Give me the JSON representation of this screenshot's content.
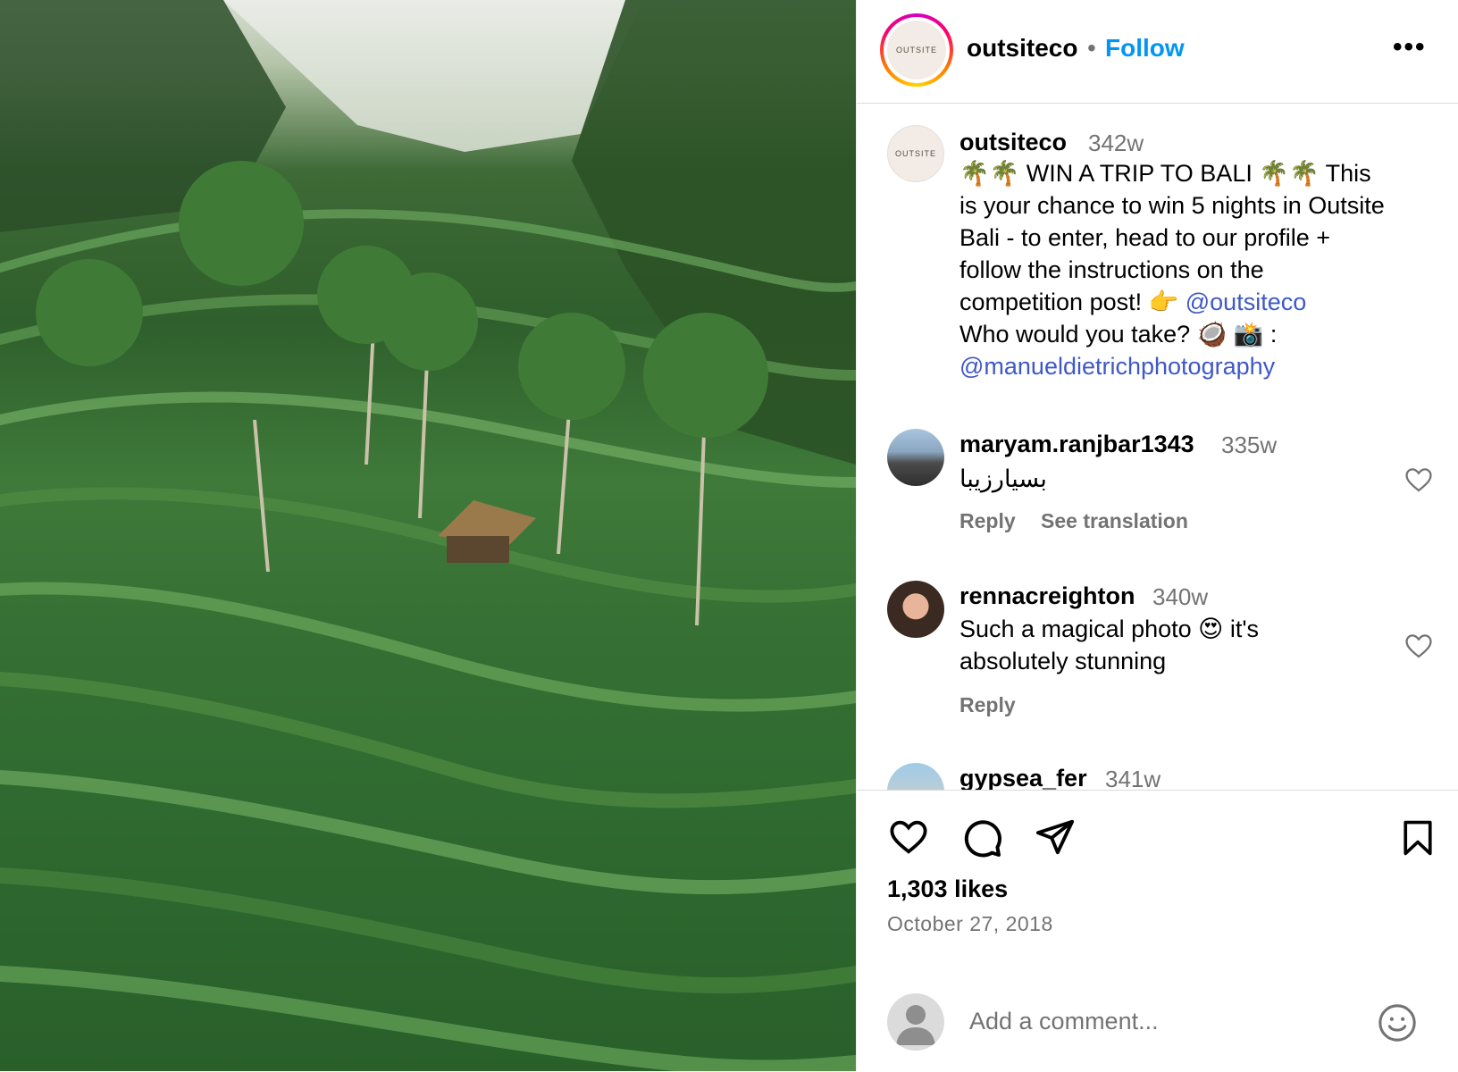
{
  "post": {
    "username": "outsiteco",
    "follow_label": "Follow",
    "more_label": "•••",
    "brand_logo_text": "OUTSITE",
    "photo_alt": ""
  },
  "caption": {
    "username": "outsiteco",
    "time": "342w",
    "line1": "🌴🌴 WIN A TRIP TO BALI 🌴🌴 This",
    "line2": "is your chance to win 5 nights in Outsite",
    "line3": "Bali - to enter, head to our profile +",
    "line4": "follow the instructions on the",
    "line5_text": "competition post! 👉",
    "line5_mention": "@outsiteco",
    "line6": "Who would you take? 🥥 📸 :",
    "line7_mention": "@manueldietrichphotography"
  },
  "comments": [
    {
      "username": "maryam.ranjbar1343",
      "time": "335w",
      "text": "بسیارزیبا",
      "reply_label": "Reply",
      "translate_label": "See translation"
    },
    {
      "username": "rennacreighton",
      "time": "340w",
      "line1": "Such a magical photo 😍 it's",
      "line2": "absolutely stunning",
      "reply_label": "Reply"
    },
    {
      "username": "gypsea_fer",
      "time": "341w"
    }
  ],
  "footer": {
    "likes": "1,303 likes",
    "date": "October 27, 2018",
    "comment_placeholder": "Add a comment..."
  },
  "icons": {
    "like": "heart-icon",
    "comment": "comment-bubble-icon",
    "share": "paper-plane-icon",
    "save": "bookmark-icon",
    "emoji": "smiley-icon",
    "more": "more-options-icon"
  },
  "colors": {
    "follow_blue": "#0095f6",
    "mention_blue": "#3f58c8",
    "muted_gray": "#737373",
    "divider": "#dbdbdb"
  }
}
